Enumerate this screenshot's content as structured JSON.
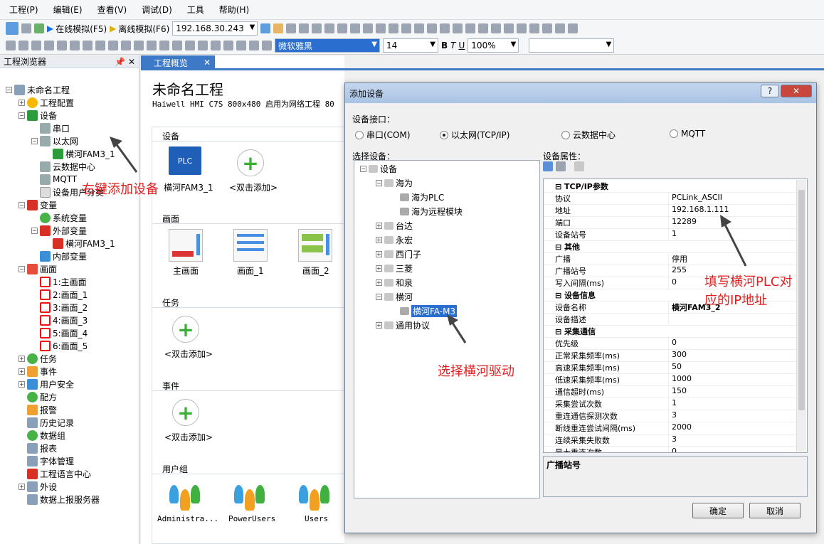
{
  "menu": [
    "工程(P)",
    "编辑(E)",
    "查看(V)",
    "调试(D)",
    "工具",
    "帮助(H)"
  ],
  "toolbar": {
    "online_sim": "在线模拟(F5)",
    "offline_sim": "离线模拟(F6)",
    "ip": "192.168.30.243",
    "font": "微软雅黑",
    "font_size": "14",
    "zoom": "100%"
  },
  "explorer": {
    "title": "工程浏览器",
    "items": [
      {
        "label": "未命名工程",
        "level": 0,
        "icon": "cube-icon"
      },
      {
        "label": "工程配置",
        "level": 1,
        "icon": "config-icon"
      },
      {
        "label": "设备",
        "level": 1,
        "icon": "device-icon"
      },
      {
        "label": "串口",
        "level": 2,
        "icon": "serial-icon"
      },
      {
        "label": "以太网",
        "level": 2,
        "icon": "ethernet-icon"
      },
      {
        "label": "横河FAM3_1",
        "level": 3,
        "icon": "plc-icon"
      },
      {
        "label": "云数据中心",
        "level": 2,
        "icon": "cloud-icon"
      },
      {
        "label": "MQTT",
        "level": 2,
        "icon": "mqtt-icon"
      },
      {
        "label": "设备用户分类",
        "level": 2,
        "icon": "category-icon"
      },
      {
        "label": "变量",
        "level": 1,
        "icon": "variable-icon"
      },
      {
        "label": "系统变量",
        "level": 2,
        "icon": "sysvar-icon"
      },
      {
        "label": "外部变量",
        "level": 2,
        "icon": "extvar-icon"
      },
      {
        "label": "横河FAM3_1",
        "level": 3,
        "icon": "extvar-item-icon"
      },
      {
        "label": "内部变量",
        "level": 2,
        "icon": "intvar-icon"
      },
      {
        "label": "画面",
        "level": 1,
        "icon": "screen-icon"
      },
      {
        "label": "1:主画面",
        "level": 2,
        "icon": "main-screen-icon"
      },
      {
        "label": "2:画面_1",
        "level": 2,
        "icon": "screen-page-icon"
      },
      {
        "label": "3:画面_2",
        "level": 2,
        "icon": "screen-page-icon"
      },
      {
        "label": "4:画面_3",
        "level": 2,
        "icon": "screen-page-icon"
      },
      {
        "label": "5:画面_4",
        "level": 2,
        "icon": "screen-page-icon"
      },
      {
        "label": "6:画面_5",
        "level": 2,
        "icon": "screen-page-icon"
      },
      {
        "label": "任务",
        "level": 1,
        "icon": "task-icon"
      },
      {
        "label": "事件",
        "level": 1,
        "icon": "event-icon"
      },
      {
        "label": "用户安全",
        "level": 1,
        "icon": "user-security-icon"
      },
      {
        "label": "配方",
        "level": 1,
        "icon": "recipe-icon"
      },
      {
        "label": "报警",
        "level": 1,
        "icon": "alarm-icon"
      },
      {
        "label": "历史记录",
        "level": 1,
        "icon": "history-icon"
      },
      {
        "label": "数据组",
        "level": 1,
        "icon": "datagroup-icon"
      },
      {
        "label": "报表",
        "level": 1,
        "icon": "report-icon"
      },
      {
        "label": "字体管理",
        "level": 1,
        "icon": "font-icon"
      },
      {
        "label": "工程语言中心",
        "level": 1,
        "icon": "language-icon"
      },
      {
        "label": "外设",
        "level": 1,
        "icon": "peripheral-icon"
      },
      {
        "label": "数据上报服务器",
        "level": 1,
        "icon": "report-server-icon"
      }
    ]
  },
  "doc": {
    "tab": "工程概览",
    "title": "未命名工程",
    "subtitle": "Haiwell HMI C7S  800x480  启用为网络工程 80",
    "sections": {
      "device": "设备",
      "screen": "画面",
      "task": "任务",
      "event": "事件",
      "usergroup": "用户组"
    },
    "device_items": [
      "横河FAM3_1",
      "<双击添加>"
    ],
    "screen_items": [
      "主画面",
      "画面_1",
      "画面_2"
    ],
    "task_add": "<双击添加>",
    "event_add": "<双击添加>",
    "user_groups": [
      "Administra...",
      "PowerUsers",
      "Users"
    ],
    "plc_badge": "PLC"
  },
  "annotations": {
    "add_device": "右键添加设备",
    "select_driver": "选择横河驱动",
    "fill_ip": "填写横河PLC对",
    "fill_ip2": "应的IP地址"
  },
  "dialog": {
    "title": "添加设备",
    "interface_label": "设备接口：",
    "interfaces": [
      "串口(COM)",
      "以太网(TCP/IP)",
      "云数据中心",
      "MQTT"
    ],
    "selected_interface": "以太网(TCP/IP)",
    "select_label": "选择设备：",
    "tree": [
      {
        "label": "设备",
        "level": 0
      },
      {
        "label": "海为",
        "level": 1
      },
      {
        "label": "海为PLC",
        "level": 2
      },
      {
        "label": "海为远程模块",
        "level": 2
      },
      {
        "label": "台达",
        "level": 1
      },
      {
        "label": "永宏",
        "level": 1
      },
      {
        "label": "西门子",
        "level": 1
      },
      {
        "label": "三菱",
        "level": 1
      },
      {
        "label": "和泉",
        "level": 1
      },
      {
        "label": "横河",
        "level": 1
      },
      {
        "label": "横河FA-M3",
        "level": 2,
        "selected": true
      },
      {
        "label": "通用协议",
        "level": 1
      }
    ],
    "props_label": "设备属性：",
    "props": [
      {
        "cat": "TCP/IP参数"
      },
      {
        "k": "协议",
        "v": "PCLink_ASCII"
      },
      {
        "k": "地址",
        "v": "192.168.1.111"
      },
      {
        "k": "端口",
        "v": "12289"
      },
      {
        "k": "设备站号",
        "v": "1"
      },
      {
        "cat": "其他"
      },
      {
        "k": "广播",
        "v": "停用"
      },
      {
        "k": "广播站号",
        "v": "255"
      },
      {
        "k": "写入间隔(ms)",
        "v": "0"
      },
      {
        "cat": "设备信息"
      },
      {
        "k": "设备名称",
        "v": "横河FAM3_2"
      },
      {
        "k": "设备描述",
        "v": ""
      },
      {
        "cat": "采集通信"
      },
      {
        "k": "优先级",
        "v": "0"
      },
      {
        "k": "正常采集频率(ms)",
        "v": "300"
      },
      {
        "k": "高速采集频率(ms)",
        "v": "50"
      },
      {
        "k": "低速采集频率(ms)",
        "v": "1000"
      },
      {
        "k": "通信超时(ms)",
        "v": "150"
      },
      {
        "k": "采集尝试次数",
        "v": "1"
      },
      {
        "k": "重连通信探测次数",
        "v": "3"
      },
      {
        "k": "断线重连尝试间隔(ms)",
        "v": "2000"
      },
      {
        "k": "连续采集失败数",
        "v": "3"
      },
      {
        "k": "最大重连次数",
        "v": "0"
      }
    ],
    "desc": "广播站号",
    "ok": "确定",
    "cancel": "取消"
  }
}
